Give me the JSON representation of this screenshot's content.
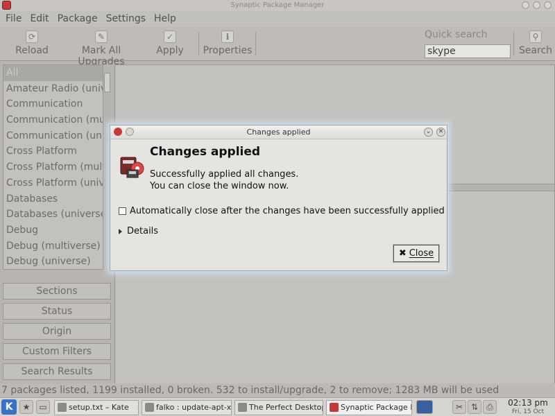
{
  "window": {
    "title": "Synaptic Package Manager"
  },
  "menu": [
    "File",
    "Edit",
    "Package",
    "Settings",
    "Help"
  ],
  "toolbar": {
    "reload": "Reload",
    "mark_all": "Mark All Upgrades",
    "apply": "Apply",
    "properties": "Properties",
    "quick_search_label": "Quick search",
    "quick_search_value": "skype",
    "search": "Search"
  },
  "sections": [
    "All",
    "Amateur Radio (universe)",
    "Communication",
    "Communication (multiverse)",
    "Communication (universe)",
    "Cross Platform",
    "Cross Platform (multiverse)",
    "Cross Platform (universe)",
    "Databases",
    "Databases (universe)",
    "Debug",
    "Debug (multiverse)",
    "Debug (universe)"
  ],
  "filter_buttons": [
    "Sections",
    "Status",
    "Origin",
    "Custom Filters",
    "Search Results"
  ],
  "status_text": "7 packages listed, 1199 installed, 0 broken. 532 to install/upgrade, 2 to remove; 1283 MB will be used",
  "dialog": {
    "title": "Changes applied",
    "heading": "Changes applied",
    "message_line1": "Successfully applied all changes.",
    "message_line2": "You can close the window now.",
    "auto_close_label": "Automatically close after the changes have been successfully applied",
    "details_label": "Details",
    "close_label": "Close"
  },
  "taskbar": {
    "tasks": [
      "setup.txt – Kate",
      "falko : update-apt-xapi",
      "The Perfect Desktop -",
      "Synaptic Package Mana"
    ],
    "clock_time": "02:13 pm",
    "clock_date": "Fri, 15 Oct"
  }
}
